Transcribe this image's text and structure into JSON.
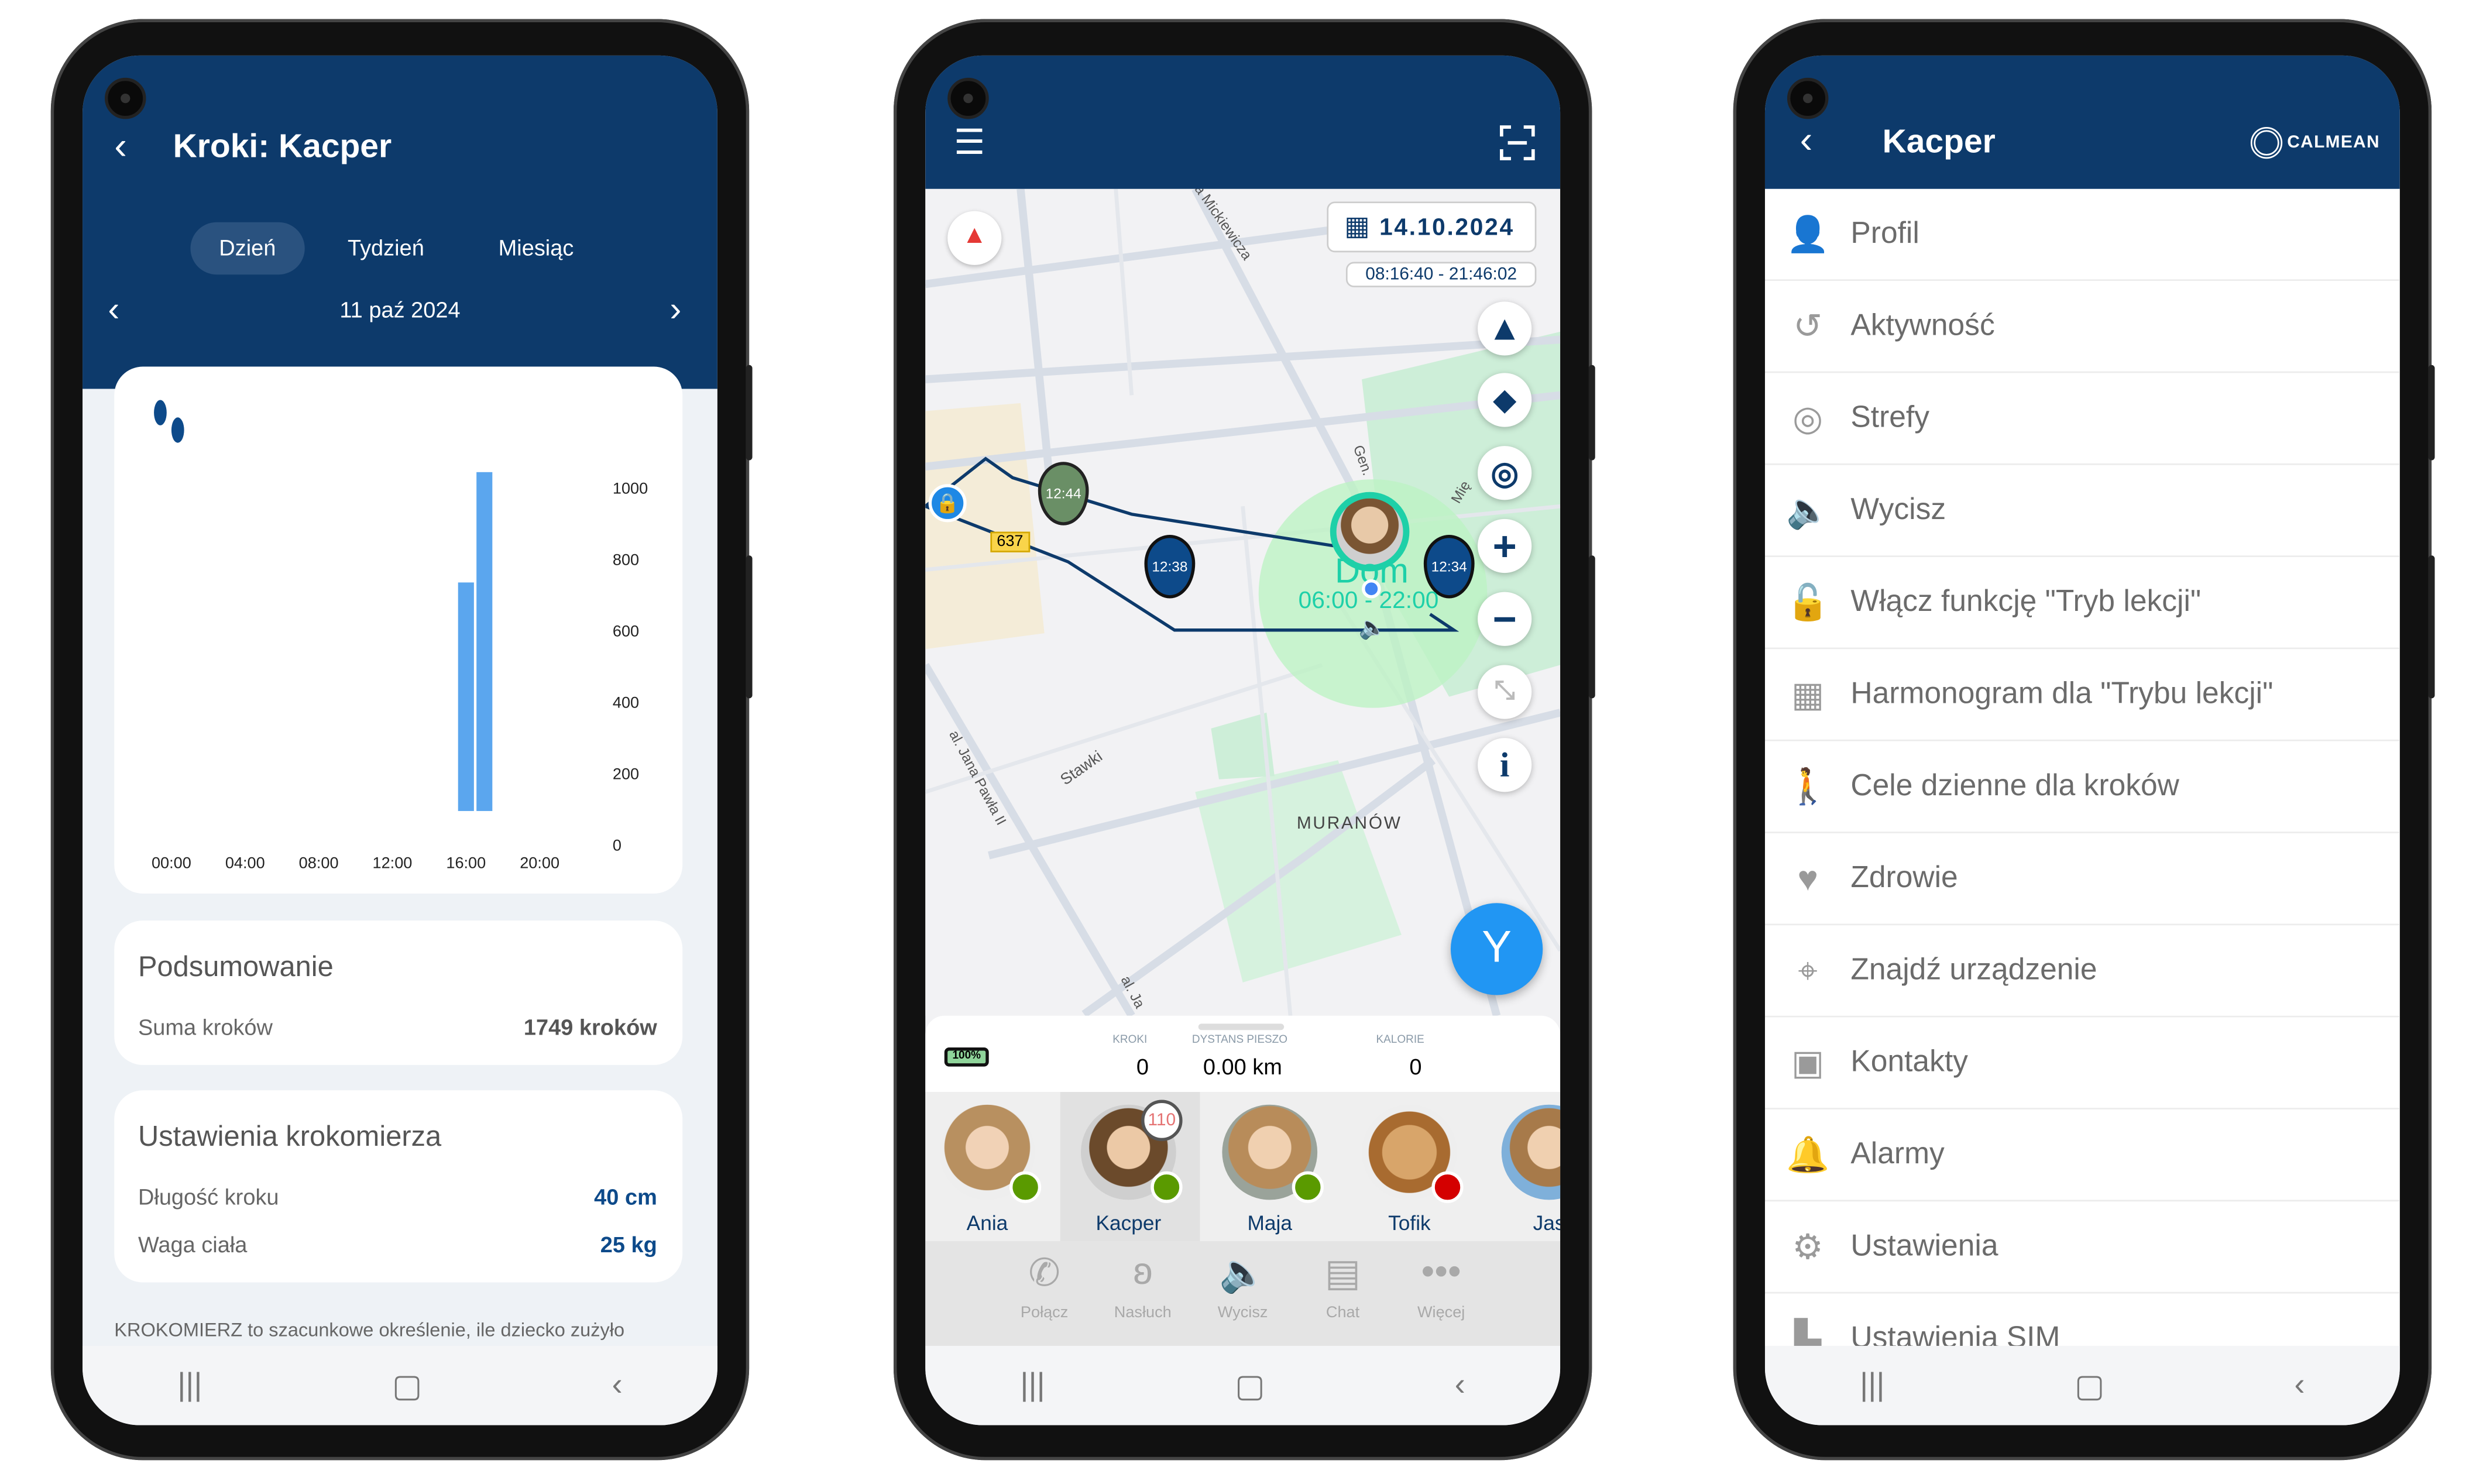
{
  "steps_screen": {
    "title": "Kroki: Kacper",
    "tabs": [
      {
        "label": "Dzień",
        "active": true
      },
      {
        "label": "Tydzień",
        "active": false
      },
      {
        "label": "Miesiąc",
        "active": false
      }
    ],
    "date": "11 paź 2024",
    "summary": {
      "heading": "Podsumowanie",
      "label": "Suma kroków",
      "value": "1749 kroków"
    },
    "settings": {
      "heading": "Ustawienia krokomierza",
      "rows": [
        {
          "label": "Długość kroku",
          "value": "40 cm"
        },
        {
          "label": "Waga ciała",
          "value": "25 kg"
        }
      ]
    },
    "footer_text": "KROKOMIERZ to szacunkowe określenie, ile dziecko zużyło"
  },
  "chart_data": {
    "type": "bar",
    "xlabel": "",
    "ylabel": "",
    "x_ticks": [
      "00:00",
      "04:00",
      "08:00",
      "12:00",
      "16:00",
      "20:00"
    ],
    "y_ticks": [
      0,
      200,
      400,
      600,
      800,
      1000
    ],
    "ylim": [
      0,
      1000
    ],
    "categories": [
      "16:00",
      "17:00"
    ],
    "values": [
      720,
      1029
    ],
    "bar_color": "#5ba6ee"
  },
  "map_screen": {
    "date": "14.10.2024",
    "time_range": "08:16:40 - 21:46:02",
    "zone": {
      "name": "Dom",
      "hours": "06:00 - 22:00"
    },
    "markers": [
      "12:44",
      "12:38",
      "12:34"
    ],
    "road_badge": "637",
    "labels": [
      "a Mickiewicza",
      "Gen.",
      "Mię",
      "MURANÓW",
      "Stawki",
      "al. Jana Pawła II",
      "al. Ja"
    ],
    "battery": "100%",
    "stats": [
      {
        "label": "KROKI",
        "value": "0"
      },
      {
        "label": "DYSTANS PIESZO",
        "value": "0.00 km"
      },
      {
        "label": "KALORIE",
        "value": "0"
      }
    ],
    "people": [
      {
        "name": "Ania",
        "status": "online",
        "status_color": "#5a9a00"
      },
      {
        "name": "Kacper",
        "status": "online",
        "status_color": "#5a9a00",
        "badge": "110",
        "selected": true
      },
      {
        "name": "Maja",
        "status": "online",
        "status_color": "#5a9a00"
      },
      {
        "name": "Tofik",
        "status": "offline",
        "status_color": "#d40000"
      },
      {
        "name": "Jas",
        "status": ""
      }
    ],
    "actions": [
      {
        "label": "Połącz",
        "icon": "phone-icon"
      },
      {
        "label": "Nasłuch",
        "icon": "ear-icon"
      },
      {
        "label": "Wycisz",
        "icon": "speaker-icon"
      },
      {
        "label": "Chat",
        "icon": "chat-icon"
      },
      {
        "label": "Więcej",
        "icon": "more-icon"
      }
    ]
  },
  "menu_screen": {
    "title": "Kacper",
    "logo": "CALMEAN",
    "items": [
      {
        "label": "Profil",
        "icon": "person-icon"
      },
      {
        "label": "Aktywność",
        "icon": "history-icon"
      },
      {
        "label": "Strefy",
        "icon": "zones-icon"
      },
      {
        "label": "Wycisz",
        "icon": "speaker-icon"
      },
      {
        "label": "Włącz funkcję \"Tryb lekcji\"",
        "icon": "lock-icon"
      },
      {
        "label": "Harmonogram dla \"Trybu lekcji\"",
        "icon": "grid-icon"
      },
      {
        "label": "Cele dzienne dla kroków",
        "icon": "walk-icon"
      },
      {
        "label": "Zdrowie",
        "icon": "heart-pulse-icon"
      },
      {
        "label": "Znajdź urządzenie",
        "icon": "crosshair-icon"
      },
      {
        "label": "Kontakty",
        "icon": "contacts-icon"
      },
      {
        "label": "Alarmy",
        "icon": "alarm-icon"
      },
      {
        "label": "Ustawienia",
        "icon": "gear-icon"
      },
      {
        "label": "Ustawienia SIM",
        "icon": "sim-icon"
      }
    ]
  },
  "colors": {
    "header": "#0d3a6b",
    "accent": "#0d4a8a",
    "zone": "#1ed0a8",
    "sos": "#2196f3"
  }
}
